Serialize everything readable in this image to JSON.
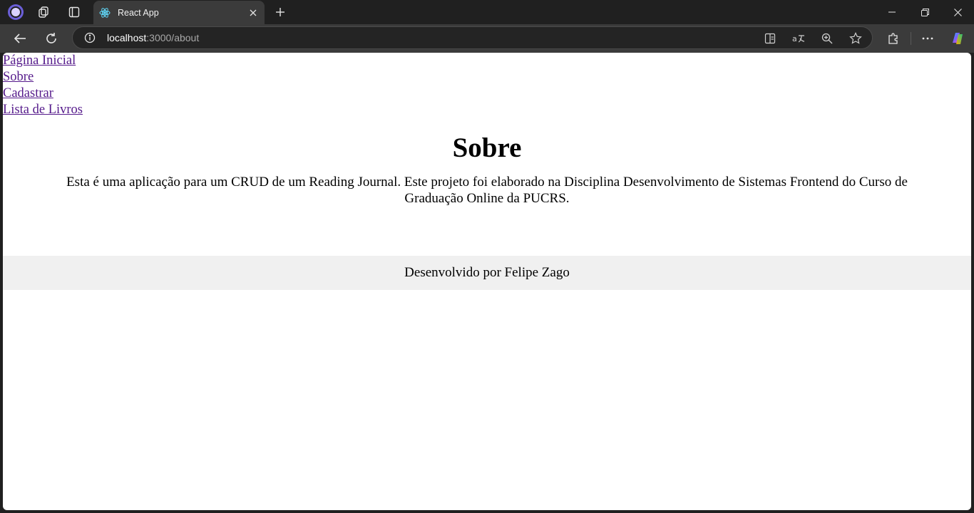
{
  "browser": {
    "tab": {
      "title": "React App"
    },
    "address": {
      "host": "localhost",
      "path": ":3000/about"
    }
  },
  "page": {
    "nav": [
      {
        "label": "Página Inicial"
      },
      {
        "label": "Sobre"
      },
      {
        "label": "Cadastrar"
      },
      {
        "label": "Lista de Livros"
      }
    ],
    "title": "Sobre",
    "description": "Esta é uma aplicação para um CRUD de um Reading Journal. Este projeto foi elaborado na Disciplina Desenvolvimento de Sistemas Frontend do Curso de Graduação Online da PUCRS.",
    "footer": "Desenvolvido por Felipe Zago"
  },
  "colors": {
    "link": "#551a8b",
    "footer_bg": "#f0f0f0",
    "chrome_dark": "#202020",
    "chrome_toolbar": "#3b3b3b"
  },
  "icons": {
    "profile": "profile-icon",
    "workspaces": "workspaces-icon",
    "tab_actions": "tab-actions-icon",
    "favicon": "react-icon",
    "close": "close-icon",
    "new_tab": "plus-icon",
    "back": "back-arrow-icon",
    "refresh": "refresh-icon",
    "site_info": "info-icon",
    "split_screen": "split-screen-icon",
    "read_aloud": "translate-icon",
    "zoom": "zoom-icon",
    "favorite": "star-icon",
    "extensions": "puzzle-icon",
    "more": "more-icon",
    "copilot": "copilot-icon"
  }
}
